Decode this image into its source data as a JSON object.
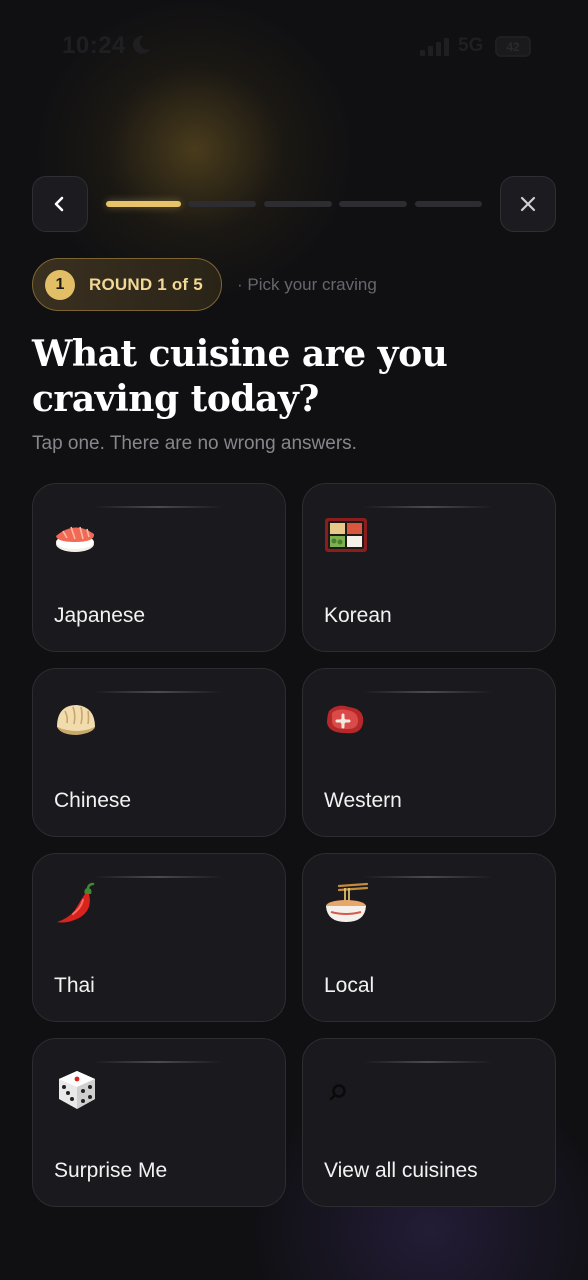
{
  "status_bar": {
    "time": "10:24",
    "network": "5G",
    "battery": "42"
  },
  "header": {
    "progress": {
      "current": 1,
      "total": 5
    }
  },
  "round": {
    "badge": "1",
    "label": "ROUND 1 of 5",
    "hint": "· Pick your craving"
  },
  "page": {
    "title": "What cuisine are you craving today?",
    "subtitle": "Tap one. There are no wrong answers."
  },
  "options": [
    {
      "label": "Japanese",
      "icon": "sushi-icon"
    },
    {
      "label": "Korean",
      "icon": "bento-box-icon"
    },
    {
      "label": "Chinese",
      "icon": "dumpling-icon"
    },
    {
      "label": "Western",
      "icon": "steak-icon"
    },
    {
      "label": "Thai",
      "icon": "chili-pepper-icon"
    },
    {
      "label": "Local",
      "icon": "noodle-bowl-icon"
    },
    {
      "label": "Surprise Me",
      "icon": "dice-icon"
    },
    {
      "label": "View all cuisines",
      "icon": "search-icon"
    }
  ],
  "colors": {
    "background": "#101013",
    "accent_gold": "#e7c46a",
    "card": "#1a1a1e",
    "card_border": "#2c2c31"
  }
}
